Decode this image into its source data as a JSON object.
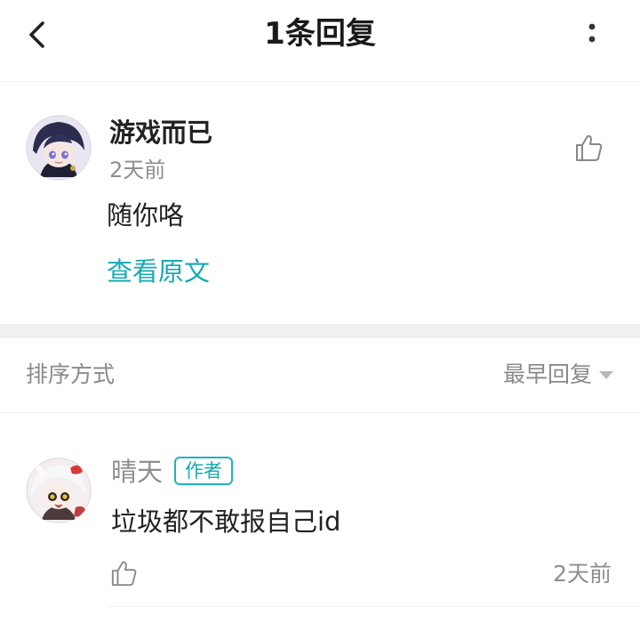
{
  "header": {
    "title": "1条回复",
    "back_icon": "chevron-left-icon",
    "more_icon": "more-vertical-icon"
  },
  "main_comment": {
    "user_name": "游戏而已",
    "time": "2天前",
    "text": "随你咯",
    "view_original_label": "查看原文",
    "like_icon": "thumbs-up-icon"
  },
  "sort": {
    "label": "排序方式",
    "selected": "最早回复",
    "caret_icon": "caret-down-icon"
  },
  "reply": {
    "user_name": "晴天",
    "badge": "作者",
    "text": "垃圾都不敢报自己id",
    "time": "2天前",
    "like_icon": "thumbs-up-icon"
  },
  "colors": {
    "accent": "#16a9b4",
    "muted_text": "#8e8e8e",
    "divider": "#eeeeee",
    "section_gap": "#f0f0f0"
  }
}
